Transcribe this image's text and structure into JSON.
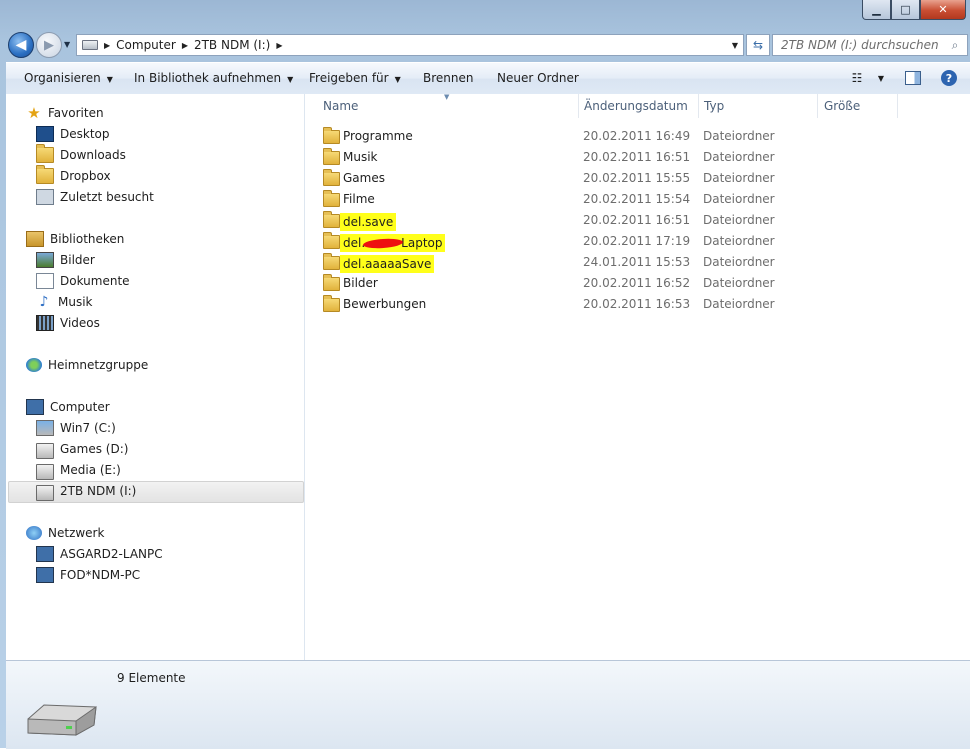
{
  "window": {
    "minimize_glyph": "▁",
    "maximize_glyph": "□",
    "close_glyph": "✕"
  },
  "address": {
    "crumbs": [
      "Computer",
      "2TB NDM (I:)"
    ],
    "back_icon": "back-arrow-icon",
    "forward_icon": "forward-arrow-icon"
  },
  "search": {
    "placeholder": "2TB NDM (I:) durchsuchen"
  },
  "toolbar": {
    "organize": "Organisieren",
    "include_library": "In Bibliothek aufnehmen",
    "share": "Freigeben für",
    "burn": "Brennen",
    "new_folder": "Neuer Ordner"
  },
  "nav": {
    "favorites": {
      "label": "Favoriten",
      "items": [
        "Desktop",
        "Downloads",
        "Dropbox",
        "Zuletzt besucht"
      ]
    },
    "libraries": {
      "label": "Bibliotheken",
      "items": [
        "Bilder",
        "Dokumente",
        "Musik",
        "Videos"
      ]
    },
    "homegroup": {
      "label": "Heimnetzgruppe"
    },
    "computer": {
      "label": "Computer",
      "items": [
        "Win7 (C:)",
        "Games (D:)",
        "Media (E:)",
        "2TB NDM (I:)"
      ],
      "selected": "2TB NDM (I:)"
    },
    "network": {
      "label": "Netzwerk",
      "items": [
        "ASGARD2-LANPC",
        "FOD*NDM-PC"
      ]
    }
  },
  "columns": {
    "name": "Name",
    "date": "Änderungsdatum",
    "type": "Typ",
    "size": "Größe"
  },
  "files": [
    {
      "name": "Programme",
      "date": "20.02.2011 16:49",
      "type": "Dateiordner"
    },
    {
      "name": "Musik",
      "date": "20.02.2011 16:51",
      "type": "Dateiordner"
    },
    {
      "name": "Games",
      "date": "20.02.2011 15:55",
      "type": "Dateiordner"
    },
    {
      "name": "Filme",
      "date": "20.02.2011 15:54",
      "type": "Dateiordner"
    },
    {
      "name": "del.save",
      "date": "20.02.2011 16:51",
      "type": "Dateiordner",
      "highlighted": true
    },
    {
      "name_prefix": "del.",
      "name_suffix": "Laptop",
      "date": "20.02.2011 17:19",
      "type": "Dateiordner",
      "highlighted": true,
      "redacted": true
    },
    {
      "name": "del.aaaaaSave",
      "date": "24.01.2011 15:53",
      "type": "Dateiordner",
      "highlighted": true
    },
    {
      "name": "Bilder",
      "date": "20.02.2011 16:52",
      "type": "Dateiordner"
    },
    {
      "name": "Bewerbungen",
      "date": "20.02.2011 16:53",
      "type": "Dateiordner"
    }
  ],
  "status": {
    "item_count": "9 Elemente"
  },
  "colors": {
    "highlight": "#ffff1a",
    "redaction": "#ee1010",
    "selection": "#e3e3e3"
  }
}
